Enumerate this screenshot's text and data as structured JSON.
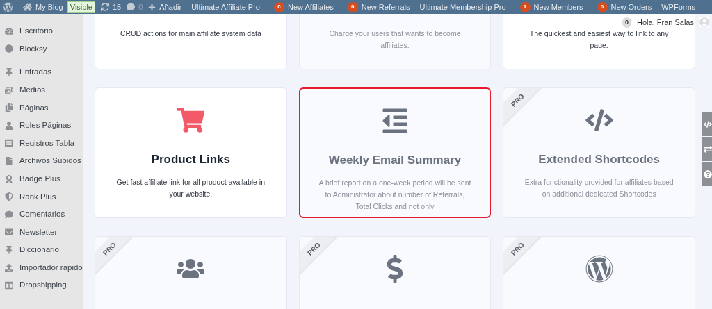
{
  "admin_bar": {
    "site": "My Blog",
    "visibility": "Visible",
    "updates": "15",
    "comments": "0",
    "new": "Añadir",
    "items": [
      {
        "label": "Ultimate Affiliate Pro"
      },
      {
        "badge": "0",
        "label": "New Affiliates"
      },
      {
        "badge": "0",
        "label": "New Referrals"
      },
      {
        "label": "Ultimate Membership Pro"
      },
      {
        "badge": "1",
        "label": "New Members"
      },
      {
        "badge": "0",
        "label": "New Orders"
      },
      {
        "label": "WPForms"
      }
    ]
  },
  "greeting": {
    "badge": "0",
    "text": "Hola, Fran Salas"
  },
  "sidebar": {
    "items": [
      {
        "label": "Escritorio"
      },
      {
        "label": "Blocksy"
      },
      {
        "label": "Entradas",
        "separated": true
      },
      {
        "label": "Medios"
      },
      {
        "label": "Páginas"
      },
      {
        "label": "Roles Páginas"
      },
      {
        "label": "Registros Tabla"
      },
      {
        "label": "Archivos Subidos"
      },
      {
        "label": "Badge Plus"
      },
      {
        "label": "Rank Plus"
      },
      {
        "label": "Comentarios"
      },
      {
        "label": "Newsletter"
      },
      {
        "label": "Diccionario"
      },
      {
        "label": "Importador rápido"
      },
      {
        "label": "Dropshipping"
      }
    ]
  },
  "cards": [
    {
      "description": "CRUD actions for main affiliate system data",
      "enabled": true,
      "pro": false,
      "selected": false
    },
    {
      "description": "Charge your users that wants to become affiliates.",
      "enabled": false,
      "pro": false,
      "selected": false
    },
    {
      "description": "The quickest and easiest way to link to any page.",
      "enabled": true,
      "pro": false,
      "selected": false
    },
    {
      "title": "Product Links",
      "description": "Get fast affiliate link for all product available in your website.",
      "enabled": true,
      "pro": false,
      "selected": false
    },
    {
      "title": "Weekly Email Summary",
      "description": "A brief report on a one-week period will be sent to Administrator about number of Referrals, Total Clicks and not only",
      "enabled": false,
      "pro": false,
      "selected": true
    },
    {
      "title": "Extended Shortcodes",
      "description": "Extra functionality provided for affiliates based on additional dedicated Shortcodes",
      "enabled": false,
      "pro": true,
      "pro_label": "PRO",
      "selected": false
    },
    {
      "enabled": false,
      "pro": true,
      "pro_label": "PRO",
      "selected": false
    },
    {
      "enabled": false,
      "pro": true,
      "pro_label": "PRO",
      "selected": false
    },
    {
      "enabled": false,
      "pro": true,
      "pro_label": "PRO",
      "selected": false
    }
  ]
}
